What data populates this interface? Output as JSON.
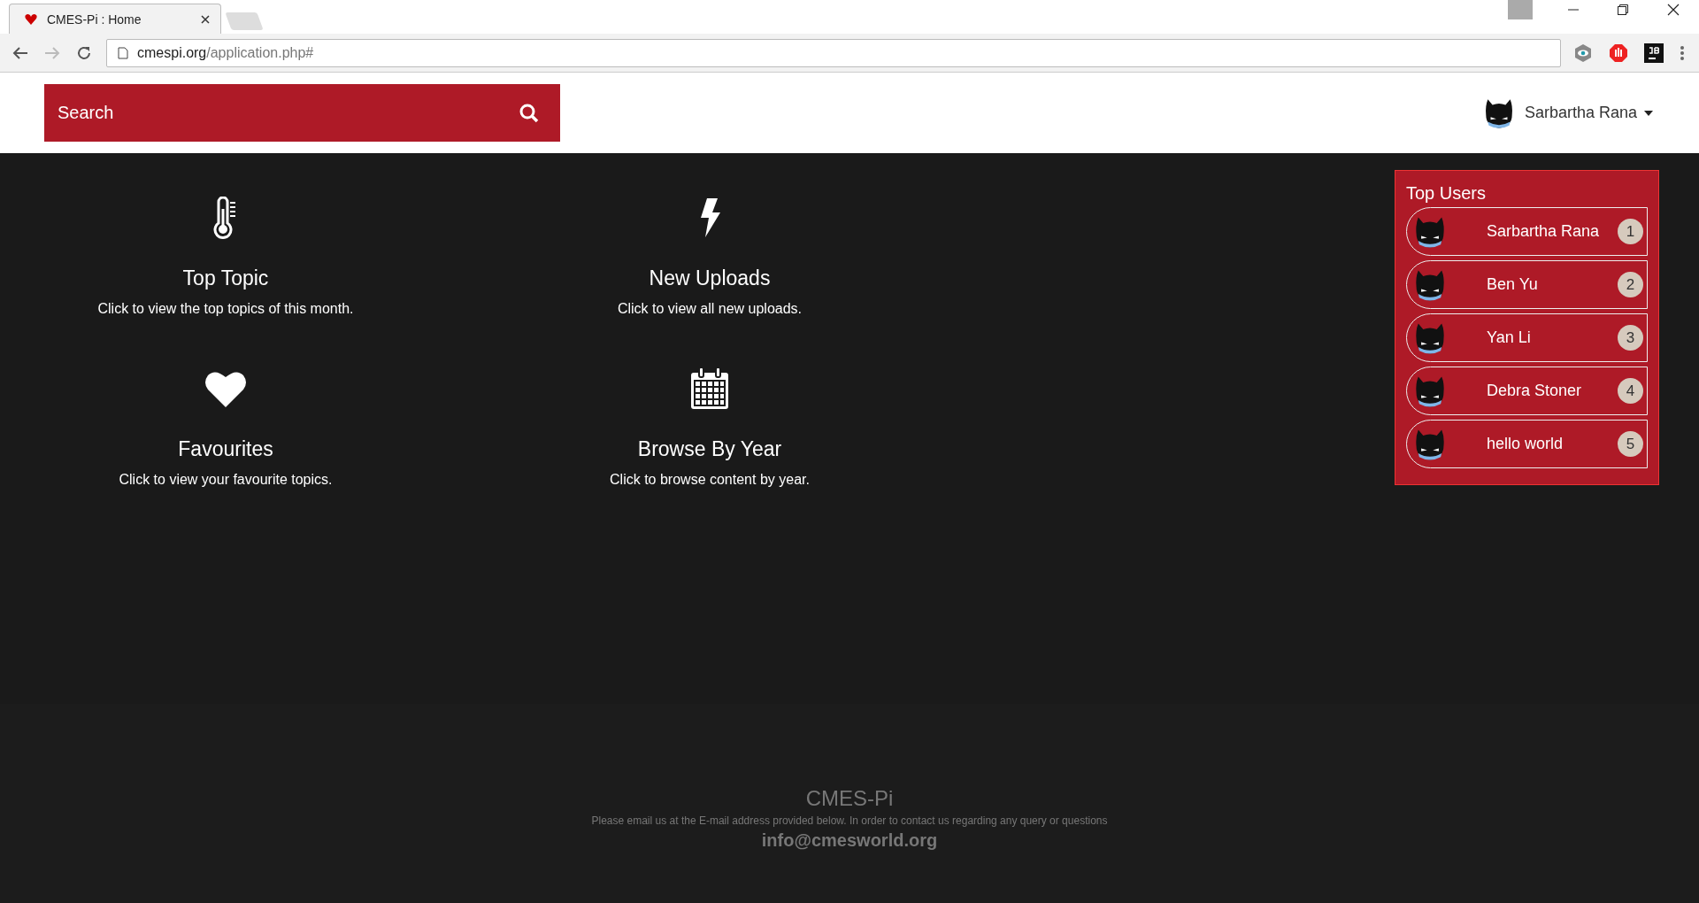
{
  "browser": {
    "tab_title": "CMES-Pi : Home",
    "url_host": "cmespi.org",
    "url_path": "/application.php#"
  },
  "header": {
    "search_placeholder": "Search",
    "user_name": "Sarbartha Rana"
  },
  "tiles": [
    {
      "kind": "thermometer",
      "title": "Top Topic",
      "description": "Click to view the top topics of this month."
    },
    {
      "kind": "bolt",
      "title": "New Uploads",
      "description": "Click to view all new uploads."
    },
    {
      "kind": "heart",
      "title": "Favourites",
      "description": "Click to view your favourite topics."
    },
    {
      "kind": "calendar",
      "title": "Browse By Year",
      "description": "Click to browse content by year."
    }
  ],
  "top_users": {
    "title": "Top Users",
    "users": [
      {
        "name": "Sarbartha Rana",
        "rank": "1"
      },
      {
        "name": "Ben Yu",
        "rank": "2"
      },
      {
        "name": "Yan Li",
        "rank": "3"
      },
      {
        "name": "Debra Stoner",
        "rank": "4"
      },
      {
        "name": "hello world",
        "rank": "5"
      }
    ]
  },
  "footer": {
    "title": "CMES-Pi",
    "note": "Please email us at the E-mail address provided below. In order to contact us regarding any query or questions",
    "email": "info@cmesworld.org"
  }
}
